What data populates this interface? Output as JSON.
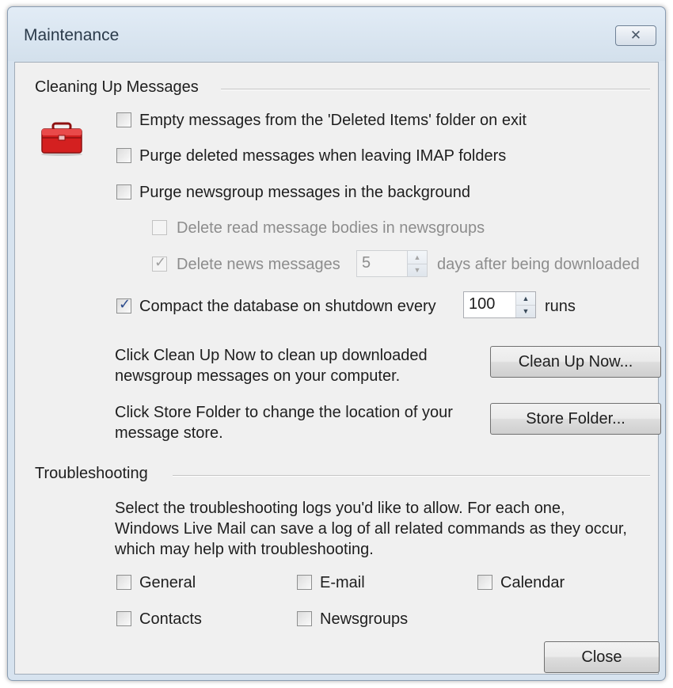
{
  "window": {
    "title": "Maintenance",
    "close_glyph": "✕"
  },
  "cleaning": {
    "group_title": "Cleaning Up Messages",
    "icon": "toolbox-icon",
    "options": [
      {
        "label": "Empty messages from the 'Deleted Items' folder on exit",
        "checked": false,
        "enabled": true
      },
      {
        "label": "Purge deleted messages when leaving IMAP folders",
        "checked": false,
        "enabled": true
      },
      {
        "label": "Purge newsgroup messages in the background",
        "checked": false,
        "enabled": true
      },
      {
        "label": "Delete read message bodies in newsgroups",
        "checked": false,
        "enabled": false
      },
      {
        "label": "Delete news messages",
        "checked": true,
        "enabled": false,
        "value": "5",
        "suffix": "days after being downloaded"
      },
      {
        "label": "Compact the database on shutdown every",
        "checked": true,
        "enabled": true,
        "value": "100",
        "suffix": "runs"
      }
    ],
    "cleanup_text": "Click Clean Up Now to clean up downloaded newsgroup messages on your computer.",
    "cleanup_button": "Clean Up Now...",
    "store_text": "Click Store Folder to change the location of your message store.",
    "store_button": "Store Folder..."
  },
  "troubleshooting": {
    "group_title": "Troubleshooting",
    "description": "Select the troubleshooting logs you'd like to allow. For each one, Windows Live Mail can save a log of all related commands as they occur, which may help with troubleshooting.",
    "logs": [
      {
        "label": "General",
        "checked": false
      },
      {
        "label": "E-mail",
        "checked": false
      },
      {
        "label": "Calendar",
        "checked": false
      },
      {
        "label": "Contacts",
        "checked": false
      },
      {
        "label": "Newsgroups",
        "checked": false
      }
    ]
  },
  "footer": {
    "close_button": "Close"
  },
  "colors": {
    "window_frame": "#d7e3ef",
    "client_bg": "#f0f0f0",
    "toolbox_red": "#d42020",
    "checkmark": "#2b4b8c"
  }
}
